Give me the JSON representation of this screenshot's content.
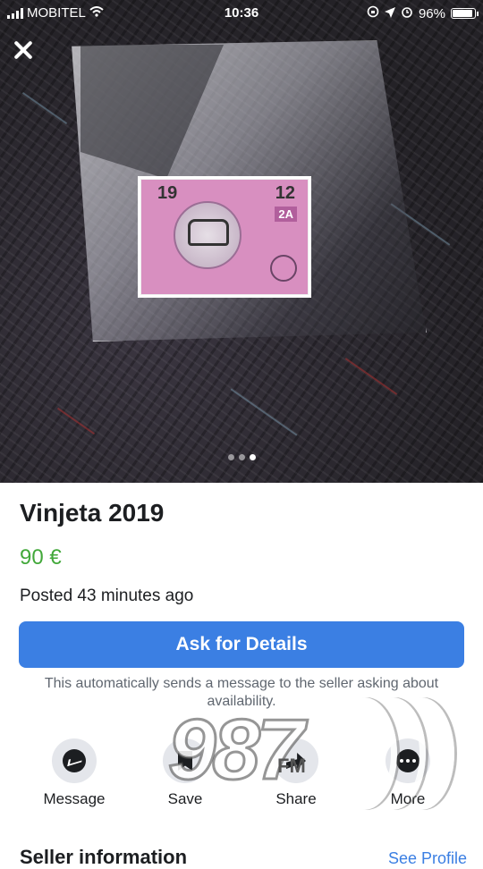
{
  "status_bar": {
    "carrier": "MOBITEL",
    "time": "10:36",
    "battery": "96%"
  },
  "photo": {
    "sticker_year": "19",
    "sticker_month": "12",
    "sticker_category": "2A",
    "dots_count": 3,
    "active_dot_index": 2
  },
  "listing": {
    "title": "Vinjeta 2019",
    "price": "90 €",
    "posted": "Posted 43 minutes ago"
  },
  "ask_button": {
    "label": "Ask for Details"
  },
  "note": "This automatically sends a message to the seller asking about availability.",
  "actions": [
    {
      "label": "Message",
      "icon": "messenger-icon"
    },
    {
      "label": "Save",
      "icon": "bookmark-icon"
    },
    {
      "label": "Share",
      "icon": "share-icon"
    },
    {
      "label": "More",
      "icon": "more-icon"
    }
  ],
  "watermark": {
    "digits": "987",
    "suffix": "FM"
  },
  "seller": {
    "heading": "Seller information",
    "link": "See Profile"
  },
  "colors": {
    "accent": "#3b7fe3",
    "price": "#42a83a"
  }
}
